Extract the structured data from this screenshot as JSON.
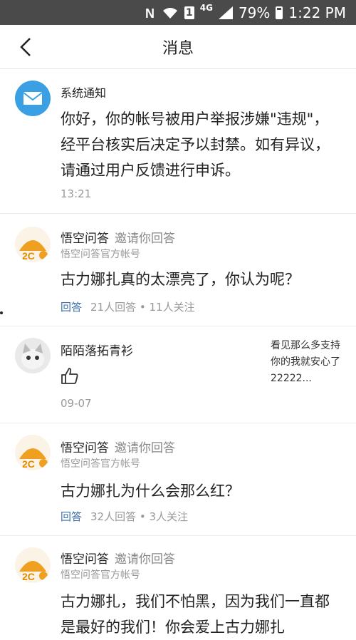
{
  "status_bar": {
    "network": "4G",
    "sim": "1",
    "battery": "79%",
    "time": "1:22 PM"
  },
  "header": {
    "title": "消息"
  },
  "messages": [
    {
      "type": "system",
      "name": "系统通知",
      "text": "你好，你的帐号被用户举报涉嫌\"违规\"，经平台核实后决定予以封禁。如有异议，请通过用户反馈进行申诉。",
      "time": "13:21"
    },
    {
      "type": "invite",
      "name": "悟空问答",
      "invite": "邀请你回答",
      "sub": "悟空问答官方帐号",
      "question": "古力娜扎真的太漂亮了，你认为呢？",
      "answer": "回答",
      "stats": "21人回答 • 11人关注"
    },
    {
      "type": "like",
      "name": "陌陌落拓青衫",
      "quote": "看见那么多支持你的我就安心了22222...",
      "time": "09-07"
    },
    {
      "type": "invite",
      "name": "悟空问答",
      "invite": "邀请你回答",
      "sub": "悟空问答官方帐号",
      "question": "古力娜扎为什么会那么红？",
      "answer": "回答",
      "stats": "32人回答 • 3人关注"
    },
    {
      "type": "invite",
      "name": "悟空问答",
      "invite": "邀请你回答",
      "sub": "悟空问答官方帐号",
      "question": "古力娜扎，我们不怕黑，因为我们一直都是最好的我们！你会爱上古力娜扎"
    }
  ],
  "colors": {
    "mail": "#3aa0e3",
    "answer_link": "#3b6fa8",
    "wukong": "#f0a020"
  }
}
